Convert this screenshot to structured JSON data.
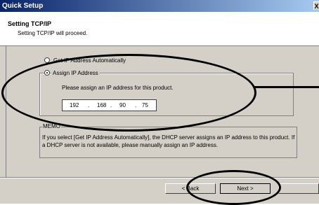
{
  "window": {
    "title": "Quick Setup",
    "close_glyph": "X"
  },
  "header": {
    "title": "Setting TCP/IP",
    "subtitle": "Setting TCP/IP will proceed."
  },
  "options": {
    "auto_label": "Get IP Address Automatically",
    "assign_label": "Assign IP Address",
    "assign_note": "Please assign an IP address for this product.",
    "selected": "assign"
  },
  "ip": {
    "octet1": "192",
    "octet2": "168",
    "octet3": "90",
    "octet4": "75",
    "dot": "."
  },
  "memo": {
    "title": "MEMO",
    "text": "If you select [Get IP Address Automatically], the DHCP server assigns an IP address to this product. If a DHCP server is not available, please manually assign an IP address."
  },
  "buttons": {
    "back": "< Back",
    "next": "Next >"
  },
  "colors": {
    "dialog_bg": "#d4d0c8",
    "title_start": "#0a246a",
    "title_end": "#a6caf0",
    "annotation": "#000000"
  }
}
